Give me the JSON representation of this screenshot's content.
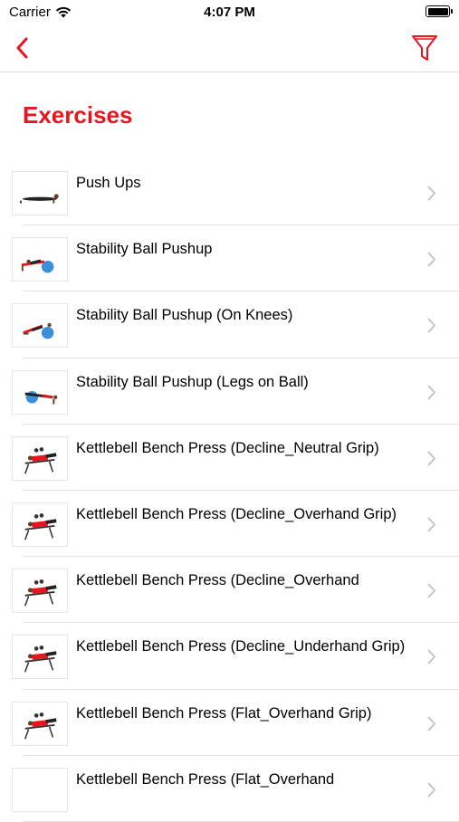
{
  "status_bar": {
    "carrier": "Carrier",
    "time": "4:07 PM"
  },
  "nav": {
    "back_icon": "chevron-left-icon",
    "filter_icon": "filter-icon"
  },
  "colors": {
    "accent": "#e8141e",
    "chevron": "#c4c4c9",
    "divider": "#e2e2e2"
  },
  "page_title": "Exercises",
  "exercises": [
    {
      "label": "Push Ups",
      "thumb": "pushup-image"
    },
    {
      "label": "Stability Ball Pushup",
      "thumb": "ball-pushup-image"
    },
    {
      "label": "Stability Ball Pushup (On Knees)",
      "thumb": "ball-pushup-knees-image"
    },
    {
      "label": "Stability Ball Pushup (Legs on Ball)",
      "thumb": "ball-pushup-legs-image"
    },
    {
      "label": "Kettlebell Bench Press (Decline_Neutral Grip)",
      "thumb": "kettlebell-bench-image"
    },
    {
      "label": "Kettlebell Bench Press (Decline_Overhand Grip)",
      "thumb": "kettlebell-bench-image"
    },
    {
      "label": "Kettlebell Bench Press (Decline_Overhand",
      "thumb": "kettlebell-bench-image"
    },
    {
      "label": "Kettlebell Bench Press (Decline_Underhand Grip)",
      "thumb": "kettlebell-bench-image"
    },
    {
      "label": "Kettlebell Bench Press (Flat_Overhand Grip)",
      "thumb": "kettlebell-bench-image"
    },
    {
      "label": "Kettlebell Bench Press (Flat_Overhand",
      "thumb": "empty-image"
    }
  ]
}
